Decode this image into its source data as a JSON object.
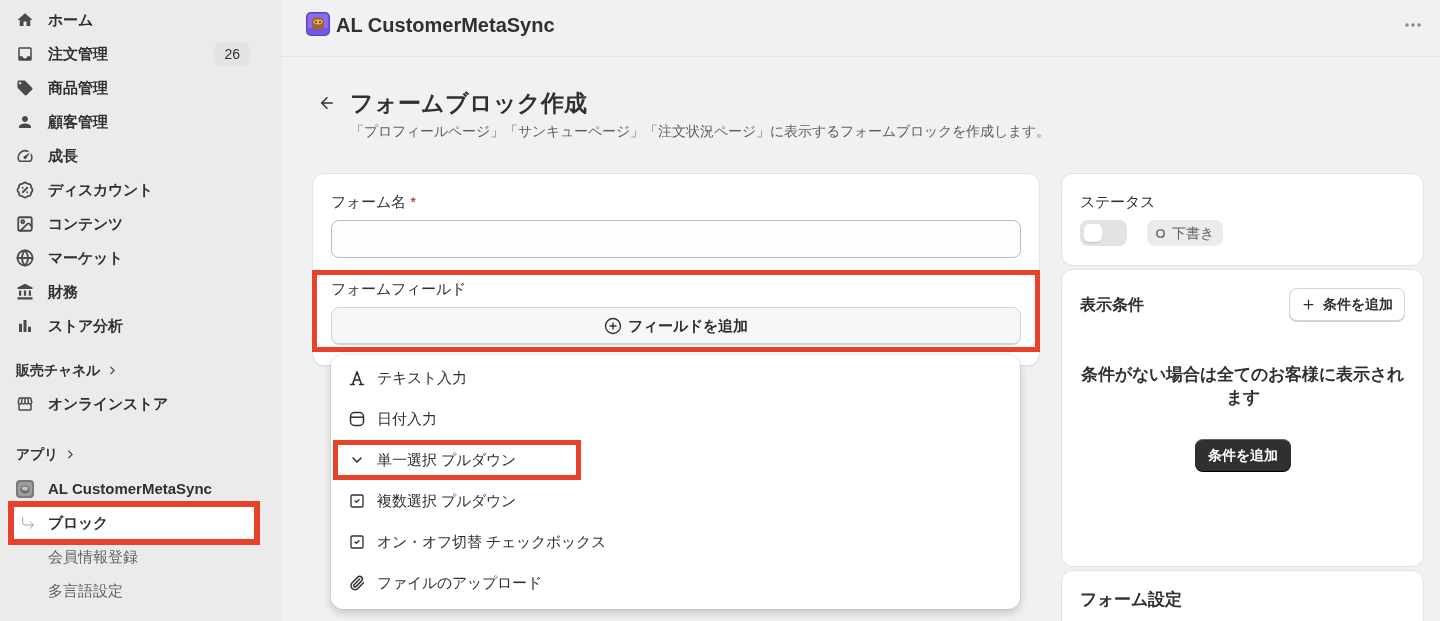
{
  "sidebar": {
    "nav_items": [
      {
        "label": "ホーム",
        "selected": false
      },
      {
        "label": "注文管理",
        "badge": "26",
        "selected": false
      },
      {
        "label": "商品管理",
        "selected": false
      },
      {
        "label": "顧客管理",
        "selected": false
      },
      {
        "label": "成長",
        "selected": false
      },
      {
        "label": "ディスカウント",
        "selected": false
      },
      {
        "label": "コンテンツ",
        "selected": false
      },
      {
        "label": "マーケット",
        "selected": false
      },
      {
        "label": "財務",
        "selected": false
      },
      {
        "label": "ストア分析",
        "selected": false
      }
    ],
    "sales_channels": {
      "heading": "販売チャネル",
      "items": [
        {
          "label": "オンラインストア",
          "selected": false
        }
      ]
    },
    "apps": {
      "heading": "アプリ",
      "items": [
        {
          "label": "AL CustomerMetaSync",
          "selected": false,
          "children": [
            {
              "label": "ブロック",
              "selected": true,
              "highlighted": true
            },
            {
              "label": "会員情報登録",
              "selected": false,
              "highlighted": false
            },
            {
              "label": "多言語設定",
              "selected": false,
              "highlighted": false
            }
          ]
        }
      ]
    }
  },
  "app_bar": {
    "title": "AL CustomerMetaSync"
  },
  "page_header": {
    "title": "フォームブロック作成",
    "subtitle": "「プロフィールページ」「サンキューページ」「注文状況ページ」に表示するフォームブロックを作成します。"
  },
  "form_card": {
    "name_field": {
      "label": "フォーム名",
      "required_mark": "*"
    },
    "fields_section": {
      "label": "フォームフィールド",
      "add_button": "フィールドを追加",
      "highlighted": true
    },
    "field_type_menu": {
      "options": [
        {
          "label": "テキスト入力",
          "highlighted": false
        },
        {
          "label": "日付入力",
          "highlighted": false
        },
        {
          "label": "単一選択 プルダウン",
          "highlighted": true
        },
        {
          "label": "複数選択 プルダウン",
          "highlighted": false
        },
        {
          "label": "オン・オフ切替 チェックボックス",
          "highlighted": false
        },
        {
          "label": "ファイルのアップロード",
          "highlighted": false
        }
      ]
    }
  },
  "status_card": {
    "title": "ステータス",
    "toggle_on": false,
    "badge": "下書き"
  },
  "conditions_card": {
    "title": "表示条件",
    "add_button": "条件を追加",
    "empty_message": "条件がない場合は全てのお客様に表示されます",
    "primary_button": "条件を追加"
  },
  "settings_card": {
    "title": "フォーム設定"
  }
}
